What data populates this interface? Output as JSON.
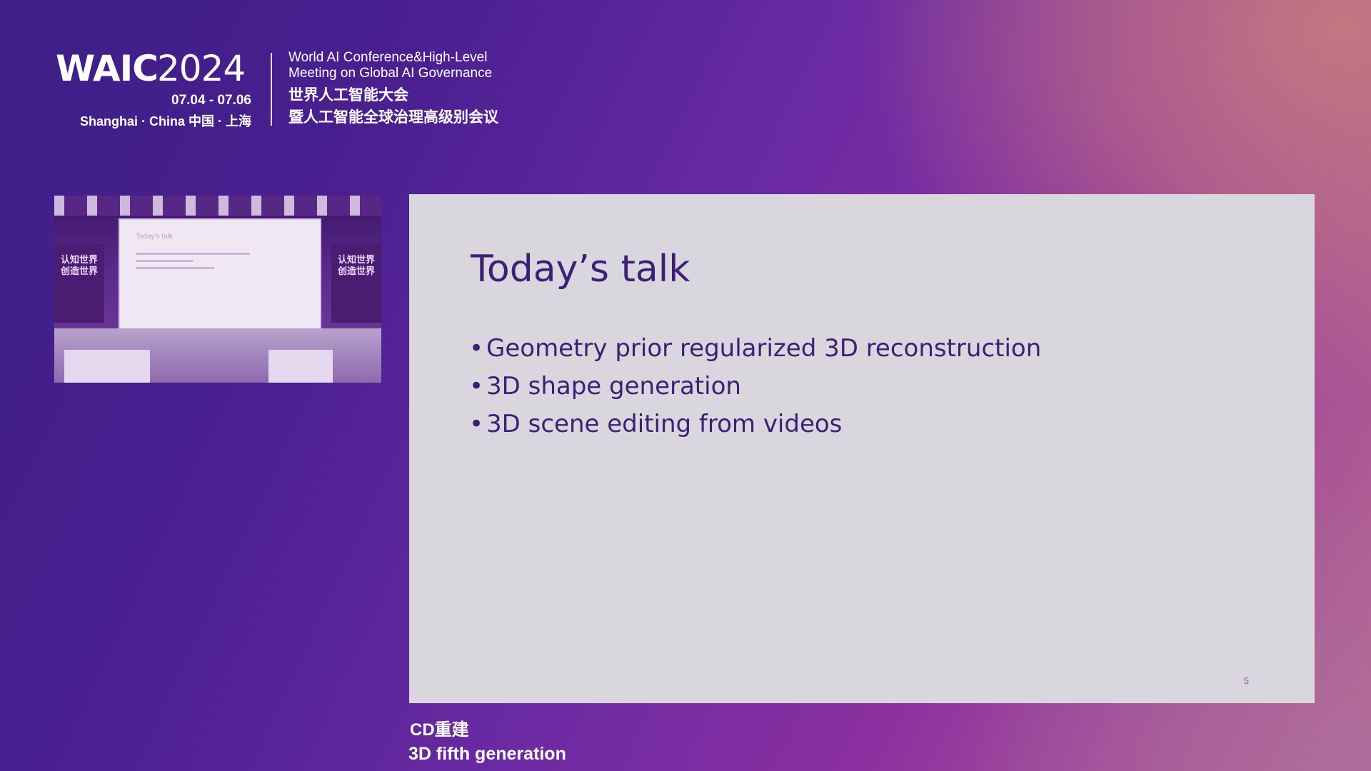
{
  "header": {
    "logo": {
      "word": "WAIC",
      "year": "2024",
      "dates": "07.04 - 07.06",
      "location": "Shanghai · China  中国 · 上海"
    },
    "conference": {
      "en_line1": "World AI Conference&High-Level",
      "en_line2": "Meeting on Global AI Governance",
      "cn_line1": "世界人工智能大会",
      "cn_line2": "暨人工智能全球治理高级别会议"
    }
  },
  "camera": {
    "screen_title": "Today's talk",
    "banner_left": "认知世界 创造世界",
    "banner_right": "认知世界 创造世界"
  },
  "slide": {
    "title": "Today’s talk",
    "bullets": [
      "Geometry prior regularized 3D reconstruction",
      "3D shape generation",
      "3D scene editing from videos"
    ],
    "bullet_symbol": "•",
    "page_number": "5"
  },
  "subtitles": {
    "cn": "CD重建",
    "en": "3D fifth generation"
  }
}
